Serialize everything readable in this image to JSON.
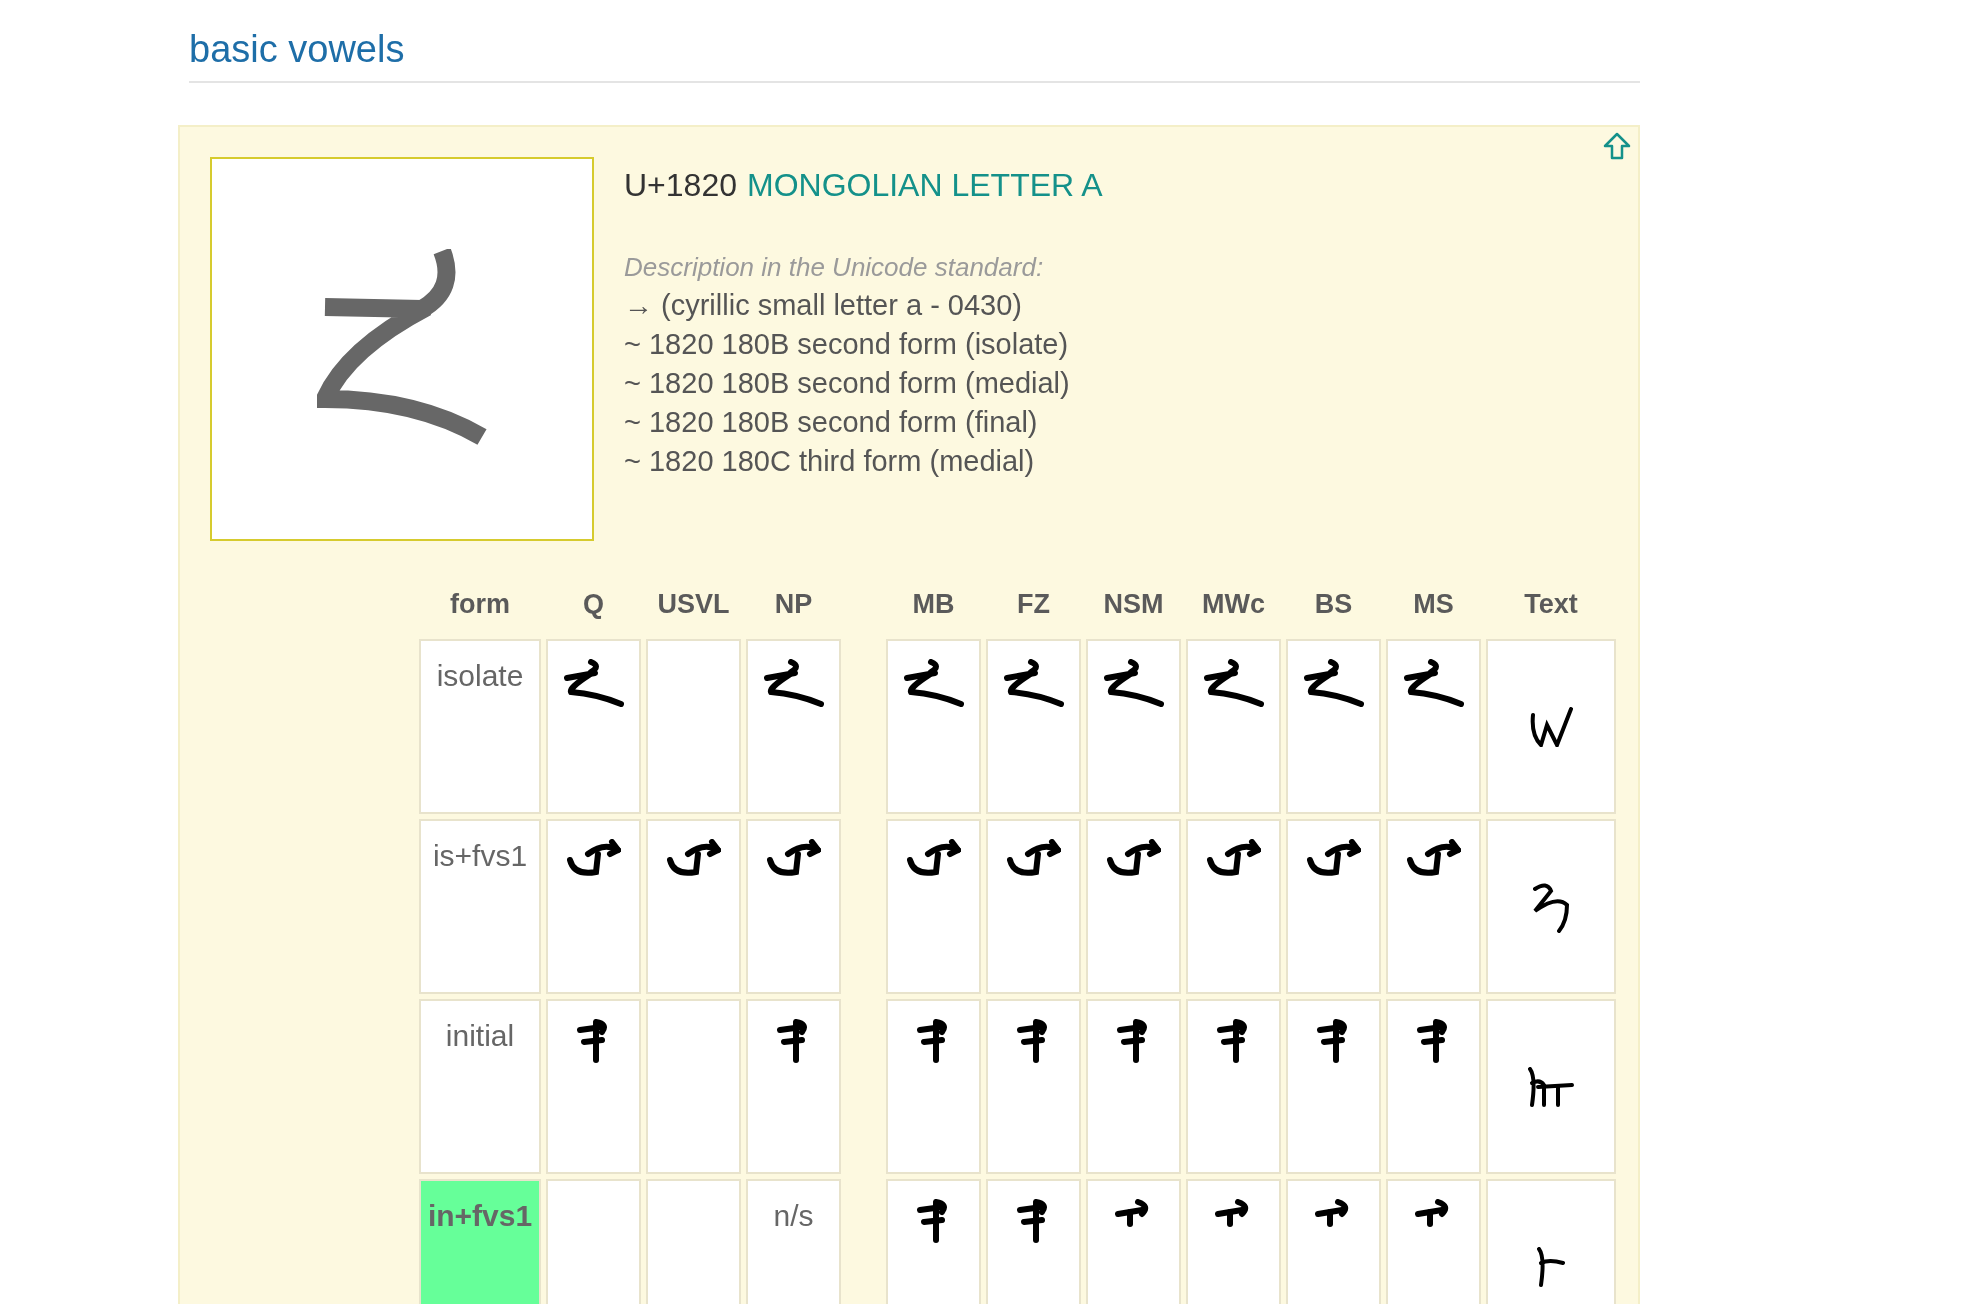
{
  "heading": "basic vowels",
  "card": {
    "codepoint": "U+1820",
    "name": "MONGOLIAN LETTER A",
    "description_label": "Description in the Unicode standard:",
    "description_lines": [
      "→ (cyrillic small letter a - 0430)",
      "~ 1820 180B second form (isolate)",
      "~ 1820 180B second form (medial)",
      "~ 1820 180B second form (final)",
      "~ 1820 180C third form (medial)"
    ]
  },
  "table": {
    "columns": [
      "form",
      "Q",
      "USVL",
      "NP",
      "MB",
      "FZ",
      "NSM",
      "MWc",
      "BS",
      "MS",
      "Text"
    ],
    "rows": [
      {
        "cells": [
          {
            "kind": "form",
            "text": "isolate",
            "highlighted": false
          },
          {
            "kind": "isolate"
          },
          {
            "kind": "empty"
          },
          {
            "kind": "isolate"
          },
          {
            "kind": "isolate"
          },
          {
            "kind": "isolate"
          },
          {
            "kind": "isolate"
          },
          {
            "kind": "isolate"
          },
          {
            "kind": "isolate"
          },
          {
            "kind": "isolate"
          },
          {
            "kind": "handisolate"
          }
        ]
      },
      {
        "cells": [
          {
            "kind": "form",
            "text": "is+fvs1",
            "highlighted": false
          },
          {
            "kind": "bowl"
          },
          {
            "kind": "bowl"
          },
          {
            "kind": "bowl"
          },
          {
            "kind": "bowl"
          },
          {
            "kind": "bowl"
          },
          {
            "kind": "bowl"
          },
          {
            "kind": "bowl"
          },
          {
            "kind": "bowl"
          },
          {
            "kind": "bowl"
          },
          {
            "kind": "handbowl"
          }
        ]
      },
      {
        "cells": [
          {
            "kind": "form",
            "text": "initial",
            "highlighted": false
          },
          {
            "kind": "initial"
          },
          {
            "kind": "empty"
          },
          {
            "kind": "initial"
          },
          {
            "kind": "initial"
          },
          {
            "kind": "initial"
          },
          {
            "kind": "initial"
          },
          {
            "kind": "initial"
          },
          {
            "kind": "initial"
          },
          {
            "kind": "initial"
          },
          {
            "kind": "handinitial"
          }
        ]
      },
      {
        "cells": [
          {
            "kind": "form",
            "text": "in+fvs1",
            "highlighted": true
          },
          {
            "kind": "empty"
          },
          {
            "kind": "empty"
          },
          {
            "kind": "text",
            "text": "n/s"
          },
          {
            "kind": "initial"
          },
          {
            "kind": "initial"
          },
          {
            "kind": "short"
          },
          {
            "kind": "short"
          },
          {
            "kind": "short"
          },
          {
            "kind": "short"
          },
          {
            "kind": "handshort"
          }
        ]
      }
    ]
  }
}
